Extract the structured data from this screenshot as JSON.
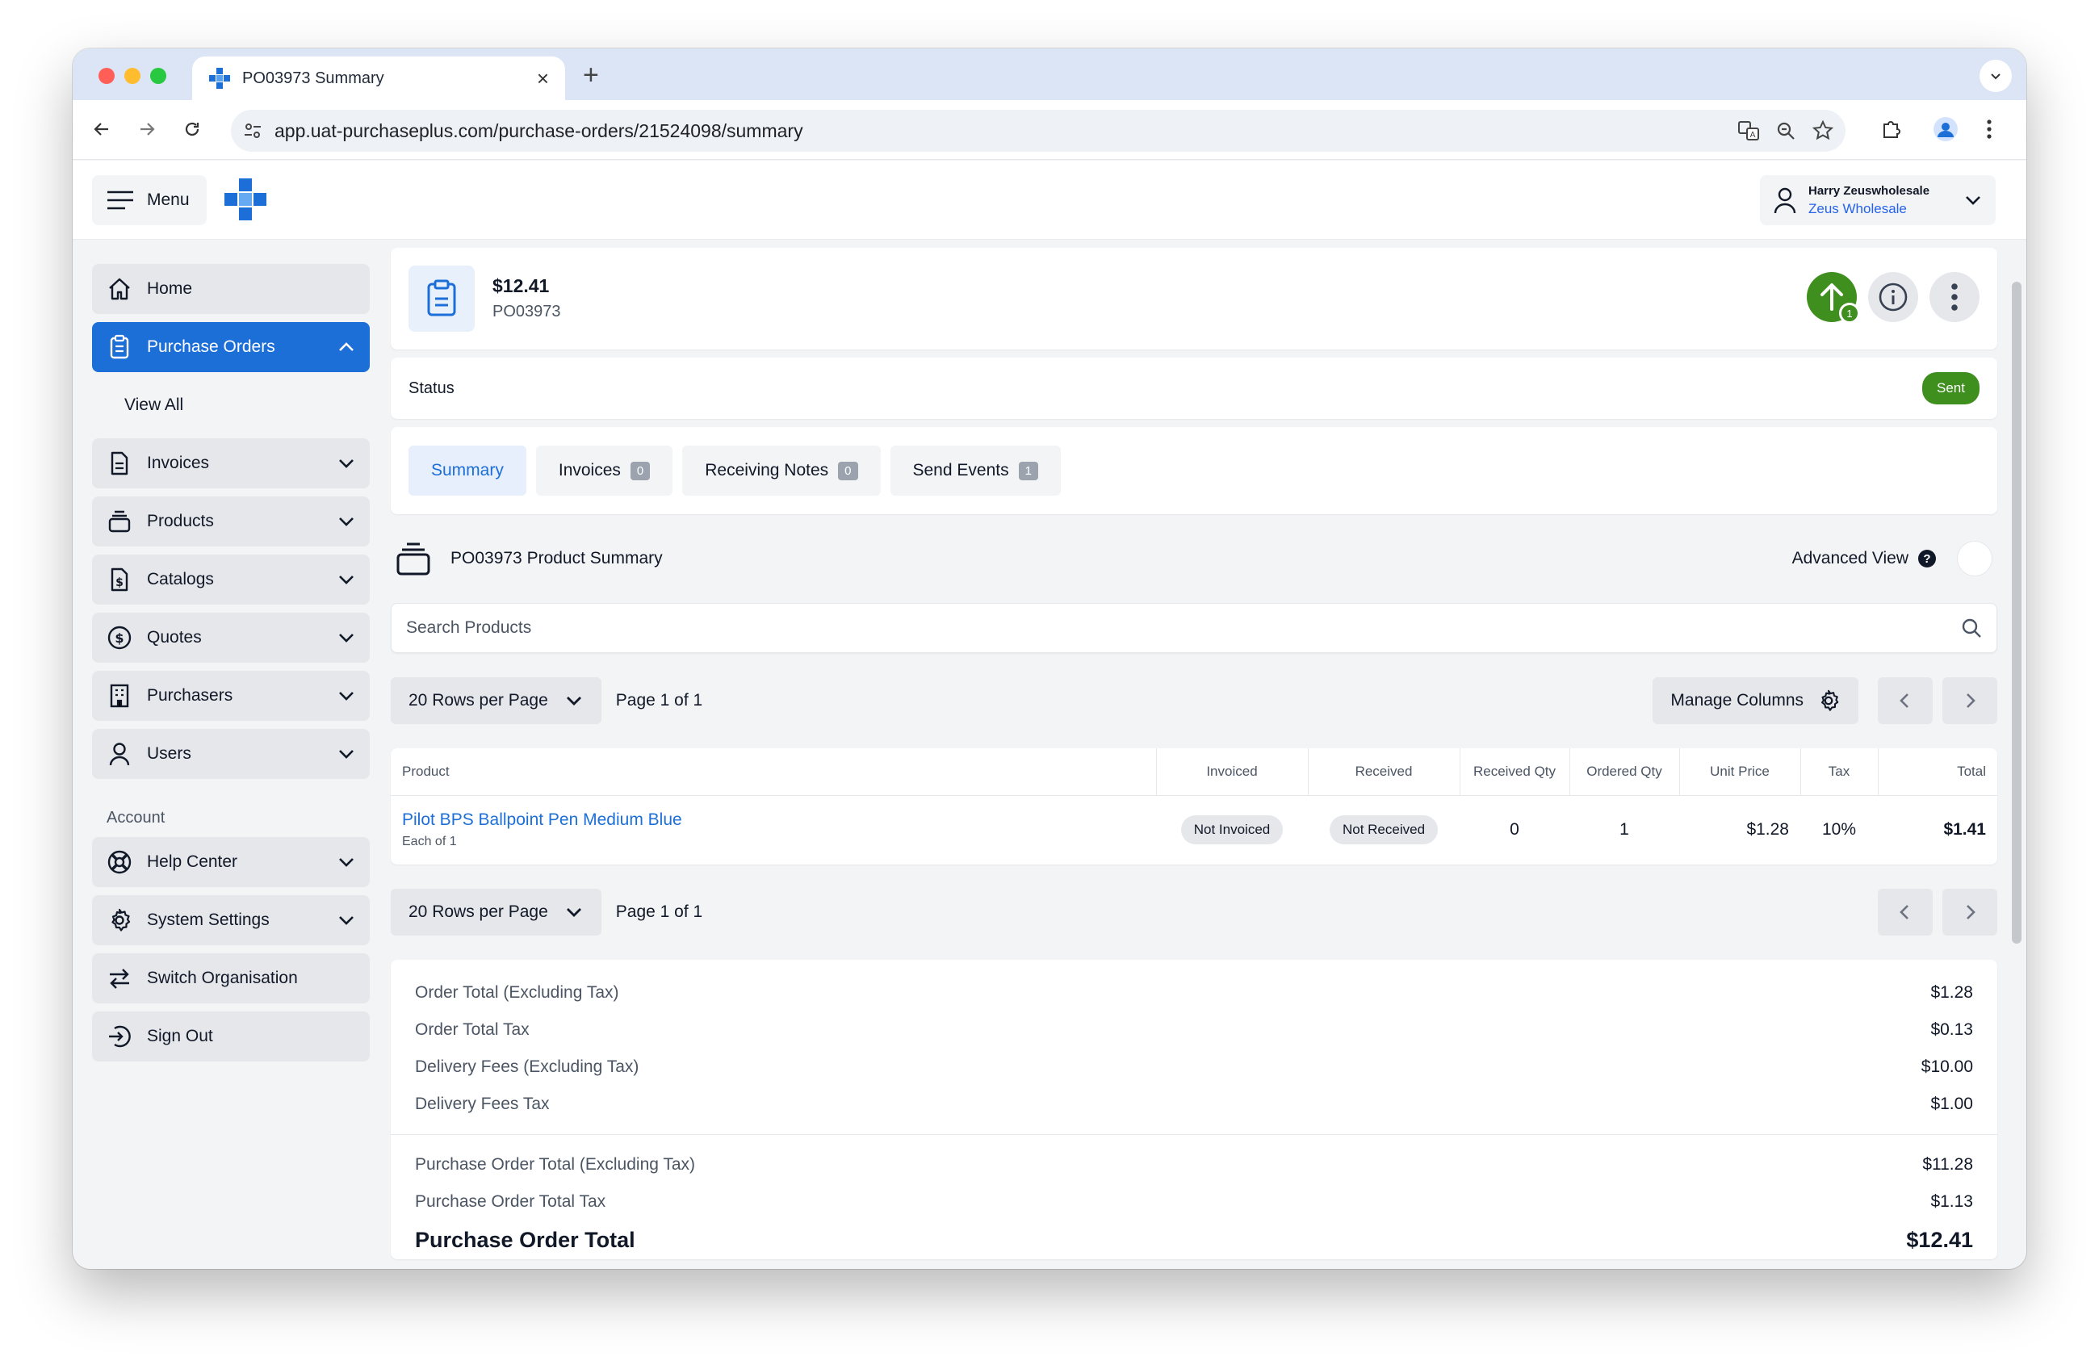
{
  "browser": {
    "tab_title": "PO03973 Summary",
    "url": "app.uat-purchaseplus.com/purchase-orders/21524098/summary"
  },
  "header": {
    "menu_label": "Menu",
    "user_name": "Harry Zeuswholesale",
    "user_org": "Zeus Wholesale"
  },
  "sidebar": {
    "items": [
      {
        "label": "Home",
        "icon": "home-icon"
      },
      {
        "label": "Purchase Orders",
        "icon": "clipboard-icon",
        "active": true
      },
      {
        "label": "View All"
      },
      {
        "label": "Invoices",
        "icon": "document-icon"
      },
      {
        "label": "Products",
        "icon": "stack-icon"
      },
      {
        "label": "Catalogs",
        "icon": "dollar-document-icon"
      },
      {
        "label": "Quotes",
        "icon": "dollar-circle-icon"
      },
      {
        "label": "Purchasers",
        "icon": "building-icon"
      },
      {
        "label": "Users",
        "icon": "user-icon"
      }
    ],
    "account_heading": "Account",
    "account_items": [
      {
        "label": "Help Center",
        "icon": "lifebuoy-icon"
      },
      {
        "label": "System Settings",
        "icon": "gear-icon"
      },
      {
        "label": "Switch Organisation",
        "icon": "switch-arrows-icon"
      },
      {
        "label": "Sign Out",
        "icon": "sign-out-icon"
      }
    ]
  },
  "po": {
    "amount": "$12.41",
    "number": "PO03973",
    "send_badge": "1",
    "status_label": "Status",
    "status_value": "Sent"
  },
  "tabs": [
    {
      "label": "Summary",
      "active": true
    },
    {
      "label": "Invoices",
      "count": "0"
    },
    {
      "label": "Receiving Notes",
      "count": "0"
    },
    {
      "label": "Send Events",
      "count": "1"
    }
  ],
  "product_summary": {
    "title": "PO03973 Product Summary",
    "advanced_view_label": "Advanced View",
    "search_placeholder": "Search Products",
    "rows_per_page": "20 Rows per Page",
    "page_text": "Page 1 of 1",
    "manage_columns": "Manage Columns"
  },
  "table": {
    "columns": [
      "Product",
      "Invoiced",
      "Received",
      "Received Qty",
      "Ordered Qty",
      "Unit Price",
      "Tax",
      "Total"
    ],
    "rows": [
      {
        "product": "Pilot BPS Ballpoint Pen Medium Blue",
        "unit": "Each of 1",
        "invoiced": "Not Invoiced",
        "received": "Not Received",
        "received_qty": "0",
        "ordered_qty": "1",
        "unit_price": "$1.28",
        "tax": "10%",
        "total": "$1.41"
      }
    ]
  },
  "totals": {
    "order_total_ex": {
      "label": "Order Total (Excluding Tax)",
      "value": "$1.28"
    },
    "order_total_tax": {
      "label": "Order Total Tax",
      "value": "$0.13"
    },
    "delivery_ex": {
      "label": "Delivery Fees (Excluding Tax)",
      "value": "$10.00"
    },
    "delivery_tax": {
      "label": "Delivery Fees Tax",
      "value": "$1.00"
    },
    "po_total_ex": {
      "label": "Purchase Order Total (Excluding Tax)",
      "value": "$11.28"
    },
    "po_total_tax": {
      "label": "Purchase Order Total Tax",
      "value": "$1.13"
    },
    "po_total": {
      "label": "Purchase Order Total",
      "value": "$12.41"
    }
  },
  "colors": {
    "primary": "#1d6fd8",
    "success": "#3f8f1f"
  }
}
